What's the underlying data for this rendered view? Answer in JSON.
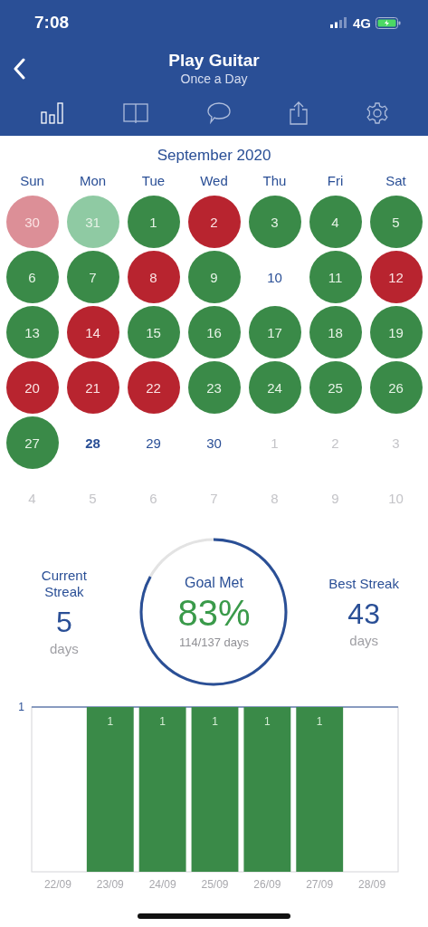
{
  "status_bar": {
    "time": "7:08",
    "network": "4G"
  },
  "header": {
    "title": "Play Guitar",
    "subtitle": "Once a Day"
  },
  "toolbar": [
    {
      "kind": "chart",
      "selected": true
    },
    {
      "kind": "book",
      "selected": false
    },
    {
      "kind": "comment",
      "selected": false
    },
    {
      "kind": "share",
      "selected": false
    },
    {
      "kind": "settings",
      "selected": false
    }
  ],
  "calendar": {
    "month": "September 2020",
    "weekdays": [
      "Sun",
      "Mon",
      "Tue",
      "Wed",
      "Thu",
      "Fri",
      "Sat"
    ],
    "days": [
      {
        "day": "30",
        "kind": "missed",
        "outside": true,
        "today": false
      },
      {
        "day": "31",
        "kind": "done",
        "outside": true,
        "today": false
      },
      {
        "day": "1",
        "kind": "done",
        "outside": false,
        "today": false
      },
      {
        "day": "2",
        "kind": "missed",
        "outside": false,
        "today": false
      },
      {
        "day": "3",
        "kind": "done",
        "outside": false,
        "today": false
      },
      {
        "day": "4",
        "kind": "done",
        "outside": false,
        "today": false
      },
      {
        "day": "5",
        "kind": "done",
        "outside": false,
        "today": false
      },
      {
        "day": "6",
        "kind": "done",
        "outside": false,
        "today": false
      },
      {
        "day": "7",
        "kind": "done",
        "outside": false,
        "today": false
      },
      {
        "day": "8",
        "kind": "missed",
        "outside": false,
        "today": false
      },
      {
        "day": "9",
        "kind": "done",
        "outside": false,
        "today": false
      },
      {
        "day": "10",
        "kind": "none",
        "outside": false,
        "today": false
      },
      {
        "day": "11",
        "kind": "done",
        "outside": false,
        "today": false
      },
      {
        "day": "12",
        "kind": "missed",
        "outside": false,
        "today": false
      },
      {
        "day": "13",
        "kind": "done",
        "outside": false,
        "today": false
      },
      {
        "day": "14",
        "kind": "missed",
        "outside": false,
        "today": false
      },
      {
        "day": "15",
        "kind": "done",
        "outside": false,
        "today": false
      },
      {
        "day": "16",
        "kind": "done",
        "outside": false,
        "today": false
      },
      {
        "day": "17",
        "kind": "done",
        "outside": false,
        "today": false
      },
      {
        "day": "18",
        "kind": "done",
        "outside": false,
        "today": false
      },
      {
        "day": "19",
        "kind": "done",
        "outside": false,
        "today": false
      },
      {
        "day": "20",
        "kind": "missed",
        "outside": false,
        "today": false
      },
      {
        "day": "21",
        "kind": "missed",
        "outside": false,
        "today": false
      },
      {
        "day": "22",
        "kind": "missed",
        "outside": false,
        "today": false
      },
      {
        "day": "23",
        "kind": "done",
        "outside": false,
        "today": false
      },
      {
        "day": "24",
        "kind": "done",
        "outside": false,
        "today": false
      },
      {
        "day": "25",
        "kind": "done",
        "outside": false,
        "today": false
      },
      {
        "day": "26",
        "kind": "done",
        "outside": false,
        "today": false
      },
      {
        "day": "27",
        "kind": "done",
        "outside": false,
        "today": false
      },
      {
        "day": "28",
        "kind": "none",
        "outside": false,
        "today": true
      },
      {
        "day": "29",
        "kind": "none",
        "outside": false,
        "today": false
      },
      {
        "day": "30",
        "kind": "none",
        "outside": false,
        "today": false
      },
      {
        "day": "1",
        "kind": "none",
        "outside": true,
        "today": false
      },
      {
        "day": "2",
        "kind": "none",
        "outside": true,
        "today": false
      },
      {
        "day": "3",
        "kind": "none",
        "outside": true,
        "today": false
      },
      {
        "day": "4",
        "kind": "none",
        "outside": true,
        "today": false
      },
      {
        "day": "5",
        "kind": "none",
        "outside": true,
        "today": false
      },
      {
        "day": "6",
        "kind": "none",
        "outside": true,
        "today": false
      },
      {
        "day": "7",
        "kind": "none",
        "outside": true,
        "today": false
      },
      {
        "day": "8",
        "kind": "none",
        "outside": true,
        "today": false
      },
      {
        "day": "9",
        "kind": "none",
        "outside": true,
        "today": false
      },
      {
        "day": "10",
        "kind": "none",
        "outside": true,
        "today": false
      }
    ]
  },
  "stats": {
    "current": {
      "label": "Current Streak",
      "value": "5",
      "unit": "days"
    },
    "goal": {
      "label": "Goal Met",
      "value": "83%",
      "detail": "114/137 days"
    },
    "best": {
      "label": "Best Streak",
      "value": "43",
      "unit": "days"
    }
  },
  "chart": {
    "chart_data": {
      "type": "bar",
      "categories": [
        "22/09",
        "23/09",
        "24/09",
        "25/09",
        "26/09",
        "27/09",
        "28/09"
      ],
      "series": [
        {
          "color": "#3a8a48",
          "values": [
            0,
            1,
            1,
            1,
            1,
            1,
            0
          ]
        }
      ],
      "ylim": [
        0,
        1
      ],
      "yticks": [
        1
      ],
      "value_labels": [
        null,
        "1",
        "1",
        "1",
        "1",
        "1",
        null
      ]
    }
  }
}
